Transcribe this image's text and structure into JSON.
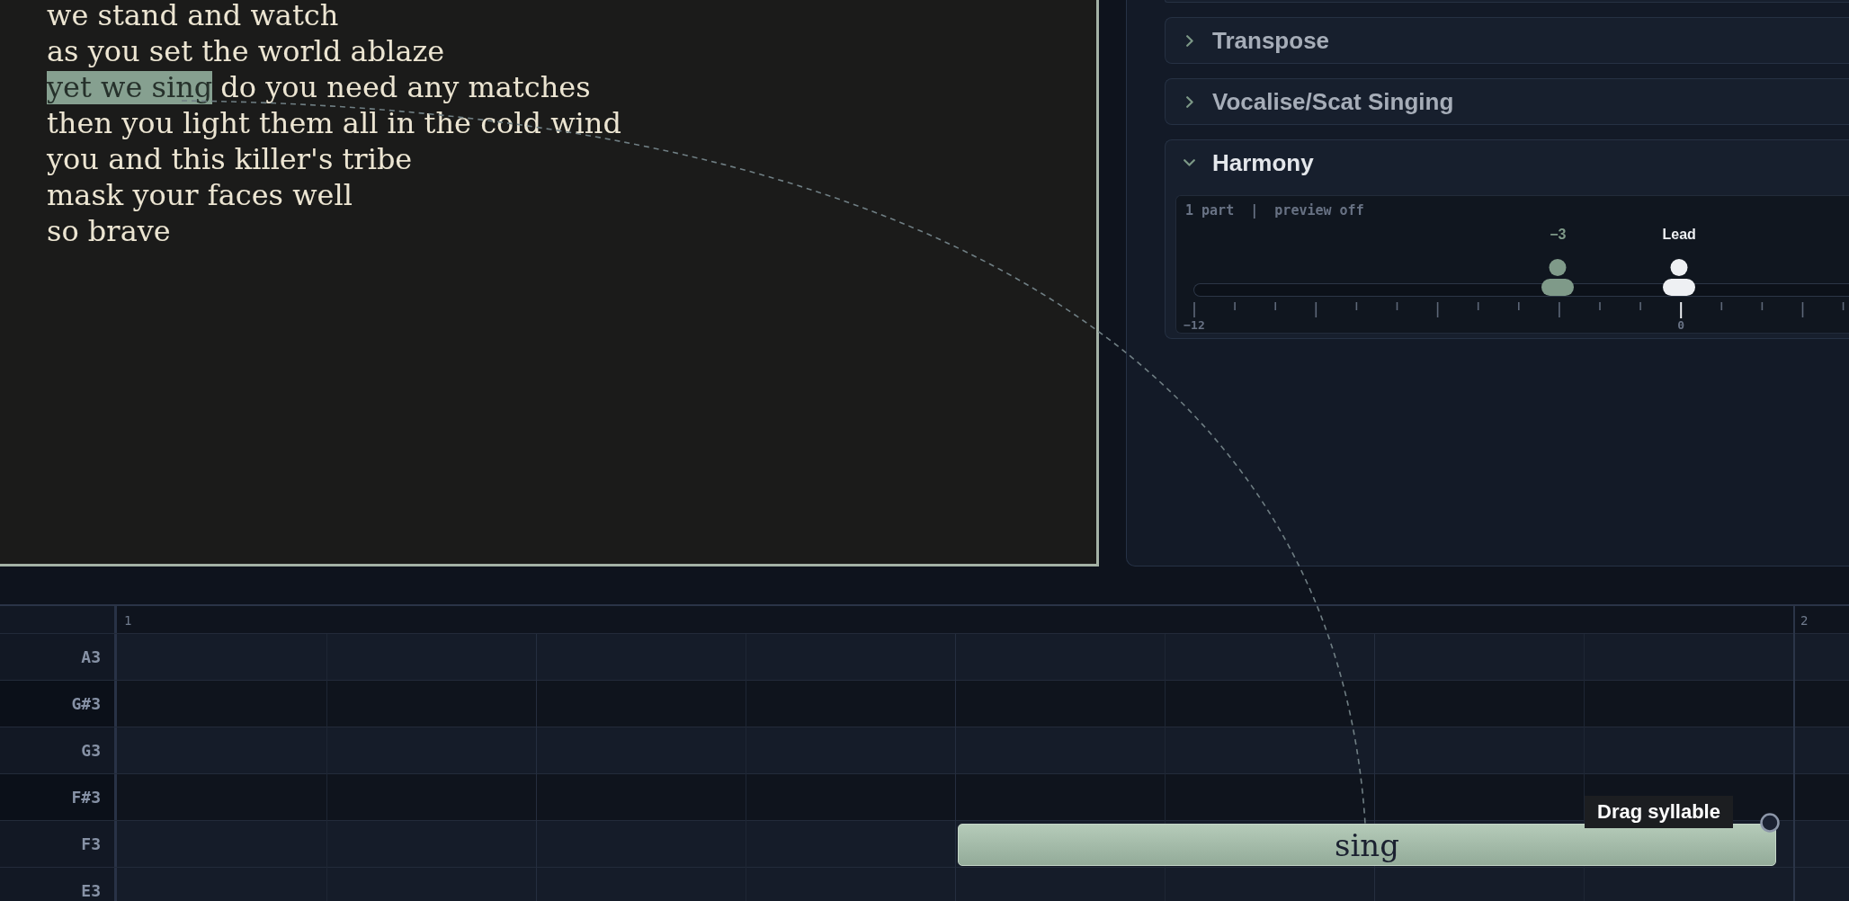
{
  "lyrics": {
    "lines": [
      {
        "segments": [
          {
            "text": "we stand and watch",
            "highlighted": false
          }
        ]
      },
      {
        "segments": [
          {
            "text": "as you set the world ablaze",
            "highlighted": false
          }
        ]
      },
      {
        "segments": [
          {
            "text": "yet we sing",
            "highlighted": true
          },
          {
            "text": "do you need any matches",
            "highlighted": false
          }
        ]
      },
      {
        "segments": [
          {
            "text": "then you light them all in the cold wind",
            "highlighted": false
          }
        ]
      },
      {
        "segments": [
          {
            "text": "you and this killer's tribe",
            "highlighted": false
          }
        ]
      },
      {
        "segments": [
          {
            "text": "mask your faces well",
            "highlighted": false
          }
        ]
      },
      {
        "segments": [
          {
            "text": "so brave",
            "highlighted": false
          }
        ]
      }
    ]
  },
  "panel": {
    "sections": [
      {
        "title": "Transpose",
        "expanded": false
      },
      {
        "title": "Vocalise/Scat Singing",
        "expanded": false
      },
      {
        "title": "Harmony",
        "expanded": true,
        "harmony": {
          "summary": "1 part  |  preview off",
          "voices": [
            {
              "label": "−3",
              "kind": "part",
              "level": 0.556
            },
            {
              "label": "Lead",
              "kind": "lead",
              "level": 0.741
            }
          ],
          "scale_labels": [
            "−12",
            "0"
          ]
        }
      }
    ]
  },
  "piano_roll": {
    "ruler": [
      "1",
      "2"
    ],
    "rows": [
      {
        "note": "A3",
        "kind": "natural"
      },
      {
        "note": "G#3",
        "kind": "sharp"
      },
      {
        "note": "G3",
        "kind": "natural"
      },
      {
        "note": "F#3",
        "kind": "sharp"
      },
      {
        "note": "F3",
        "kind": "natural",
        "syllables": [
          {
            "text": "sing",
            "tooltip": "Drag syllable"
          }
        ]
      },
      {
        "note": "E3",
        "kind": "natural"
      }
    ]
  }
}
